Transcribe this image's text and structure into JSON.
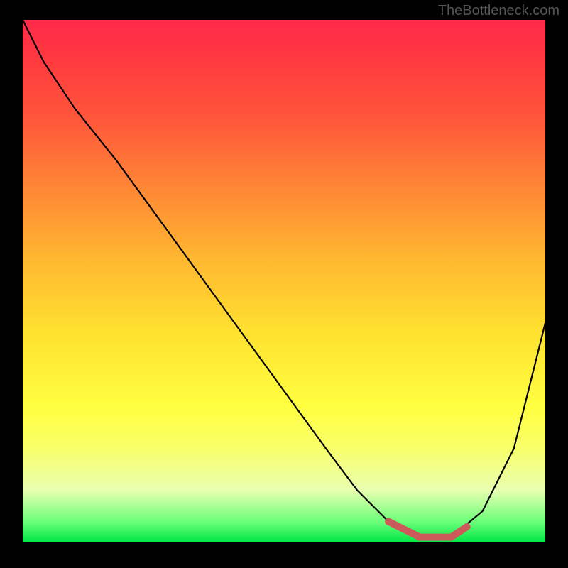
{
  "watermark": "TheBottleneck.com",
  "chart_data": {
    "type": "line",
    "title": "",
    "xlabel": "",
    "ylabel": "",
    "xlim": [
      0,
      100
    ],
    "ylim": [
      0,
      100
    ],
    "series": [
      {
        "name": "curve",
        "type": "line",
        "color": "#000000",
        "x": [
          0,
          4,
          10,
          18,
          26,
          34,
          42,
          50,
          58,
          64,
          70,
          76,
          82,
          88,
          94,
          100
        ],
        "y": [
          100,
          92,
          83,
          73,
          62,
          51,
          40,
          29,
          18,
          10,
          4,
          1,
          1,
          6,
          18,
          42
        ]
      },
      {
        "name": "highlight-segment",
        "type": "line",
        "color": "#cc5a5a",
        "thick": true,
        "x": [
          70,
          76,
          82,
          85
        ],
        "y": [
          4,
          1,
          1,
          3
        ]
      }
    ],
    "gradient_stops": [
      {
        "pos": 0,
        "color": "#ff2a4a"
      },
      {
        "pos": 8,
        "color": "#ff3a3f"
      },
      {
        "pos": 20,
        "color": "#ff5a3a"
      },
      {
        "pos": 33,
        "color": "#ff8a35"
      },
      {
        "pos": 46,
        "color": "#ffb830"
      },
      {
        "pos": 60,
        "color": "#ffe22f"
      },
      {
        "pos": 74,
        "color": "#ffff40"
      },
      {
        "pos": 82,
        "color": "#f8ff6a"
      },
      {
        "pos": 90,
        "color": "#e8ffb0"
      },
      {
        "pos": 96,
        "color": "#6cff7a"
      },
      {
        "pos": 100,
        "color": "#00e645"
      }
    ]
  }
}
